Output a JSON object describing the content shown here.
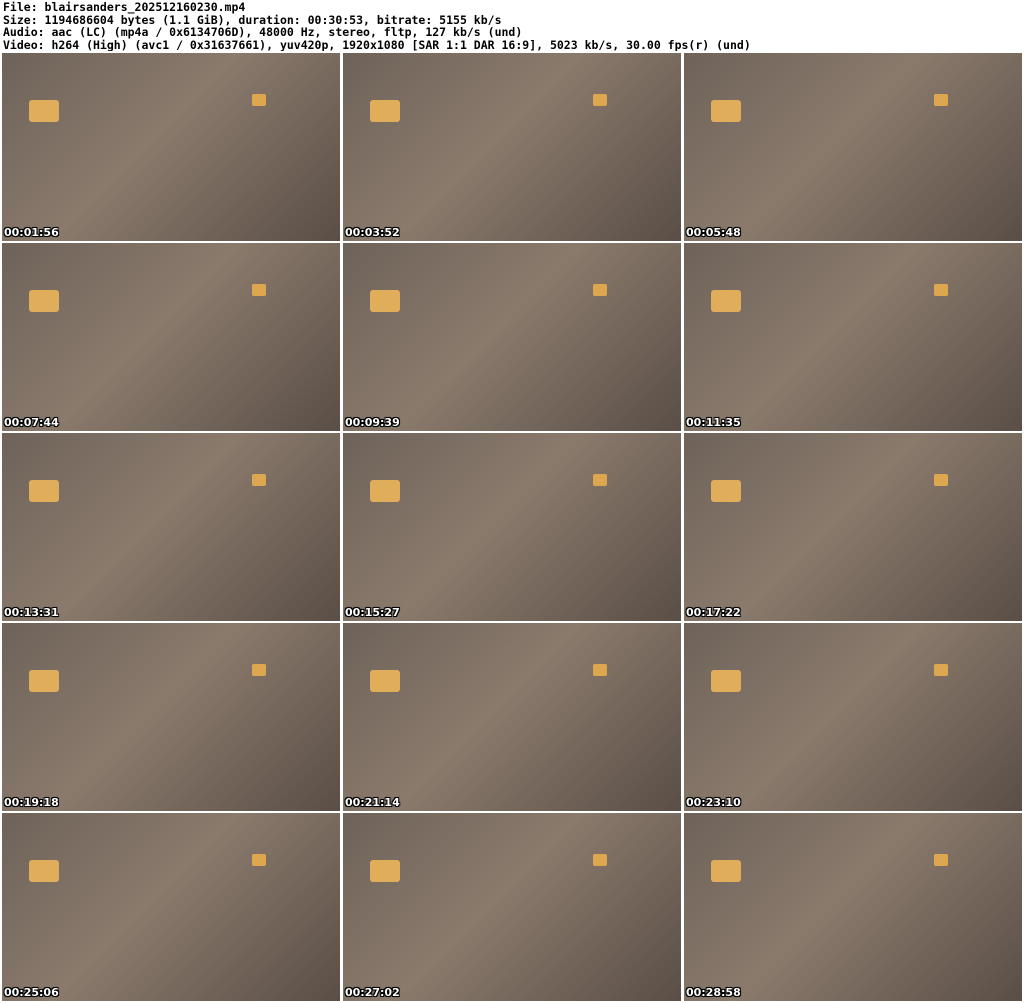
{
  "header": {
    "file": "File: blairsanders_202512160230.mp4",
    "size": "Size: 1194686604 bytes (1.1 GiB), duration: 00:30:53, bitrate: 5155 kb/s",
    "audio": "Audio: aac (LC) (mp4a / 0x6134706D), 48000 Hz, stereo, fltp, 127 kb/s (und)",
    "video": "Video: h264 (High) (avc1 / 0x31637661), yuv420p, 1920x1080 [SAR 1:1 DAR 16:9], 5023 kb/s, 30.00 fps(r) (und)"
  },
  "thumbnails": [
    {
      "timestamp": "00:01:56"
    },
    {
      "timestamp": "00:03:52"
    },
    {
      "timestamp": "00:05:48"
    },
    {
      "timestamp": "00:07:44"
    },
    {
      "timestamp": "00:09:39"
    },
    {
      "timestamp": "00:11:35"
    },
    {
      "timestamp": "00:13:31"
    },
    {
      "timestamp": "00:15:27"
    },
    {
      "timestamp": "00:17:22"
    },
    {
      "timestamp": "00:19:18"
    },
    {
      "timestamp": "00:21:14"
    },
    {
      "timestamp": "00:23:10"
    },
    {
      "timestamp": "00:25:06"
    },
    {
      "timestamp": "00:27:02"
    },
    {
      "timestamp": "00:28:58"
    }
  ]
}
